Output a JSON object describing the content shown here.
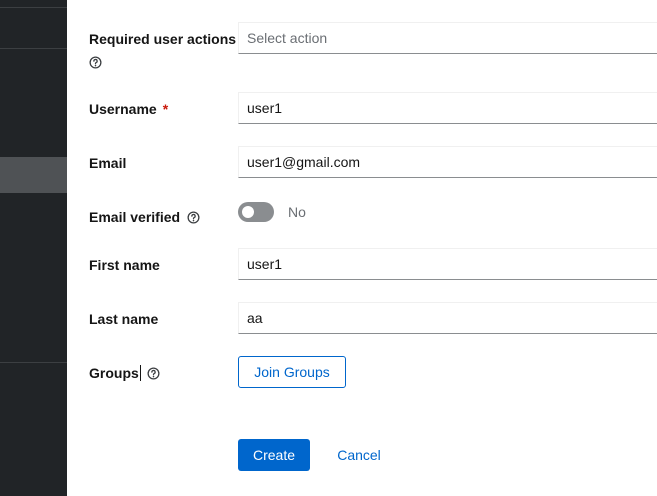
{
  "form": {
    "required_actions": {
      "label": "Required user actions",
      "placeholder": "Select action"
    },
    "username": {
      "label": "Username",
      "required_mark": "*",
      "value": "user1"
    },
    "email": {
      "label": "Email",
      "value": "user1@gmail.com"
    },
    "email_verified": {
      "label": "Email verified",
      "state_text": "No",
      "checked": false
    },
    "first_name": {
      "label": "First name",
      "value": "user1"
    },
    "last_name": {
      "label": "Last name",
      "value": "aa"
    },
    "groups": {
      "label": "Groups",
      "button_label": "Join Groups"
    }
  },
  "actions": {
    "create_label": "Create",
    "cancel_label": "Cancel"
  },
  "colors": {
    "sidebar_bg": "#212427",
    "sidebar_active": "#4f5255",
    "primary": "#0066cc",
    "required": "#c9190b",
    "toggle_off": "#8a8d90"
  },
  "icons": {
    "help": "help-icon"
  }
}
